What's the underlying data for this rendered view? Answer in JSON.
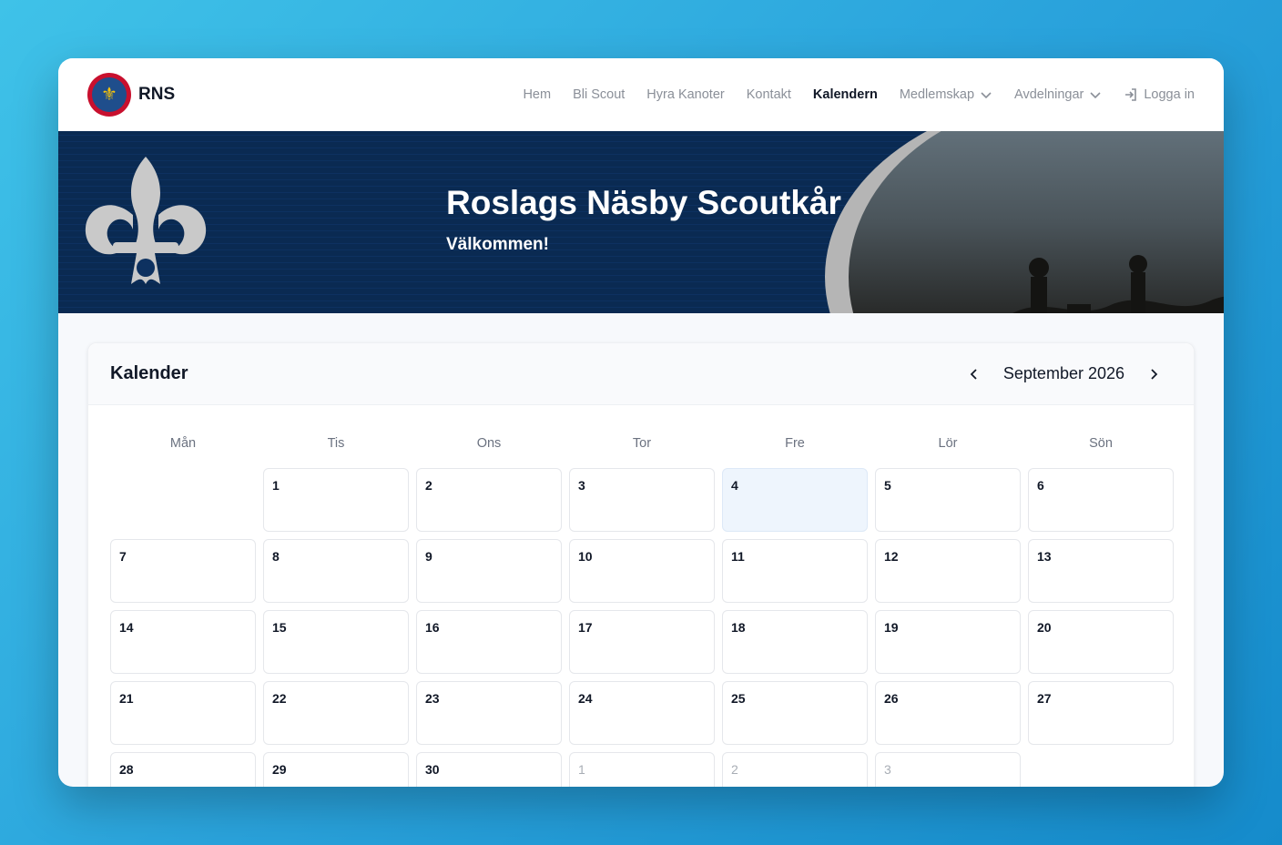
{
  "brand": {
    "name": "RNS",
    "logo_icon": "scout-emblem-icon"
  },
  "nav": {
    "items": [
      {
        "label": "Hem"
      },
      {
        "label": "Bli Scout"
      },
      {
        "label": "Hyra Kanoter"
      },
      {
        "label": "Kontakt"
      },
      {
        "label": "Kalendern",
        "active": true
      },
      {
        "label": "Medlemskap",
        "dropdown": true
      },
      {
        "label": "Avdelningar",
        "dropdown": true
      }
    ],
    "login_label": "Logga in"
  },
  "hero": {
    "title": "Roslags Näsby Scoutkår",
    "subtitle": "Välkommen!"
  },
  "calendar": {
    "title": "Kalender",
    "month_label": "September 2026",
    "weekdays": [
      "Mån",
      "Tis",
      "Ons",
      "Tor",
      "Fre",
      "Lör",
      "Sön"
    ],
    "cells": [
      "",
      "1",
      "2",
      "3",
      "4",
      "5",
      "6",
      "7",
      "8",
      "9",
      "10",
      "11",
      "12",
      "13",
      "14",
      "15",
      "16",
      "17",
      "18",
      "19",
      "20",
      "21",
      "22",
      "23",
      "24",
      "25",
      "26",
      "27",
      "28",
      "29",
      "30",
      "1",
      "2",
      "3",
      ""
    ],
    "today_index": 4,
    "other_month_indices": [
      31,
      32,
      33
    ]
  },
  "colors": {
    "accent_today": "#eef5fd",
    "hero_bg": "#0a2a52",
    "page_bg_gradient_start": "#3fc2e8",
    "page_bg_gradient_end": "#158bcb"
  }
}
